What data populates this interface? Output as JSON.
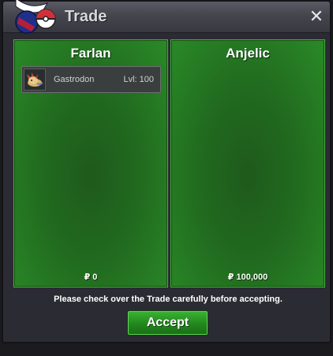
{
  "window": {
    "title": "Trade",
    "close_label": "✕"
  },
  "left_panel": {
    "player": "Farlan",
    "items": [
      {
        "name": "Gastrodon",
        "level": "Lvl: 100",
        "icon": "gastrodon-sprite-icon"
      }
    ],
    "money": "₽ 0"
  },
  "right_panel": {
    "player": "Anjelic",
    "items": [],
    "money": "₽ 100,000"
  },
  "footer": {
    "notice": "Please check over the Trade carefully before accepting.",
    "accept_label": "Accept"
  },
  "colors": {
    "panel_green": "#216a1f",
    "panel_border": "#46b53f",
    "accept_green": "#22871d",
    "window_bg": "#2b2b33"
  }
}
